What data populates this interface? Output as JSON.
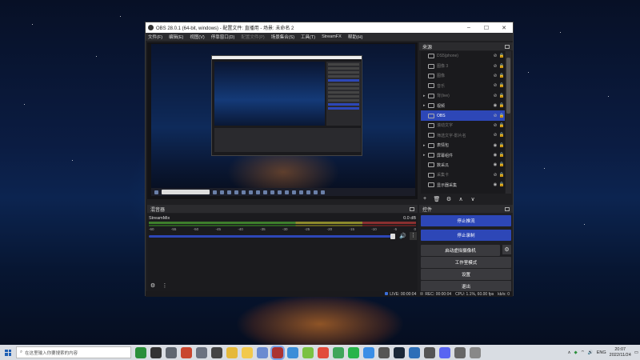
{
  "window": {
    "title": "OBS 28.0.1 (64-bit, windows) - 配置文件: 直播用 - 场景: 未命名 2",
    "controls": {
      "minimize": "–",
      "maximize": "☐",
      "close": "✕"
    }
  },
  "menu": [
    {
      "label": "文件(F)",
      "enabled": true
    },
    {
      "label": "编辑(E)",
      "enabled": true
    },
    {
      "label": "视图(V)",
      "enabled": true
    },
    {
      "label": "停靠窗口(D)",
      "enabled": true
    },
    {
      "label": "配置文件(P)",
      "enabled": false
    },
    {
      "label": "场景集合(S)",
      "enabled": true
    },
    {
      "label": "工具(T)",
      "enabled": true
    },
    {
      "label": "StreamFX",
      "enabled": true
    },
    {
      "label": "帮助(H)",
      "enabled": true
    }
  ],
  "sources": {
    "title": "来源",
    "items": [
      {
        "label": "DS5(phone)",
        "dim": true,
        "selected": false,
        "expand": "",
        "eye": "⊘"
      },
      {
        "label": "图像 3",
        "dim": true,
        "selected": false,
        "expand": "",
        "eye": "⊘"
      },
      {
        "label": "图像",
        "dim": true,
        "selected": false,
        "expand": "",
        "eye": "⊘"
      },
      {
        "label": "音乐",
        "dim": true,
        "selected": false,
        "expand": "",
        "eye": "⊘"
      },
      {
        "label": "背(live)",
        "dim": true,
        "selected": false,
        "expand": "▸",
        "eye": "⊘"
      },
      {
        "label": "视频",
        "dim": false,
        "selected": false,
        "expand": "▸",
        "eye": "◉"
      },
      {
        "label": "OBS",
        "dim": false,
        "selected": true,
        "expand": "",
        "eye": "⊘"
      },
      {
        "label": "滚动文字",
        "dim": true,
        "selected": false,
        "expand": "",
        "eye": "⊘"
      },
      {
        "label": "筛选文字-影片名",
        "dim": true,
        "selected": false,
        "expand": "",
        "eye": "⊘"
      },
      {
        "label": "表情包",
        "dim": false,
        "selected": false,
        "expand": "▸",
        "eye": "◉"
      },
      {
        "label": "屏幕组件",
        "dim": false,
        "selected": false,
        "expand": "▸",
        "eye": "◉"
      },
      {
        "label": "数采瓜",
        "dim": false,
        "selected": false,
        "expand": "",
        "eye": "◉"
      },
      {
        "label": "采集卡",
        "dim": true,
        "selected": false,
        "expand": "",
        "eye": "⊘"
      },
      {
        "label": "显示器采集",
        "dim": false,
        "selected": false,
        "expand": "",
        "eye": "◉"
      }
    ],
    "tools": {
      "add": "+",
      "remove": "🗑",
      "props": "⚙",
      "up": "∧",
      "down": "∨"
    }
  },
  "mixer": {
    "title": "混音器",
    "track": "StreamMix",
    "db": "0.0 dB",
    "ticks": [
      "-60",
      "-55",
      "-50",
      "-45",
      "-40",
      "-35",
      "-30",
      "-25",
      "-20",
      "-15",
      "-10",
      "-5",
      "0"
    ],
    "volume": 0.98
  },
  "controls": {
    "title": "控件",
    "stop_stream": "停止推流",
    "stop_record": "停止录制",
    "virtual_cam": "启动虚拟摄像机",
    "studio_mode": "工作室模式",
    "settings": "设置",
    "exit": "退出"
  },
  "status": {
    "live": "LIVE: 00:00:04",
    "rec": "REC: 00:00:04",
    "cpu": "CPU: 1.1%, 60.00 fps",
    "kbs": "kb/s: 0"
  },
  "taskbar": {
    "search_placeholder": "在这里输入你要搜索的内容",
    "lang": "ENG",
    "time": "20:07",
    "date": "2022/11/24"
  }
}
